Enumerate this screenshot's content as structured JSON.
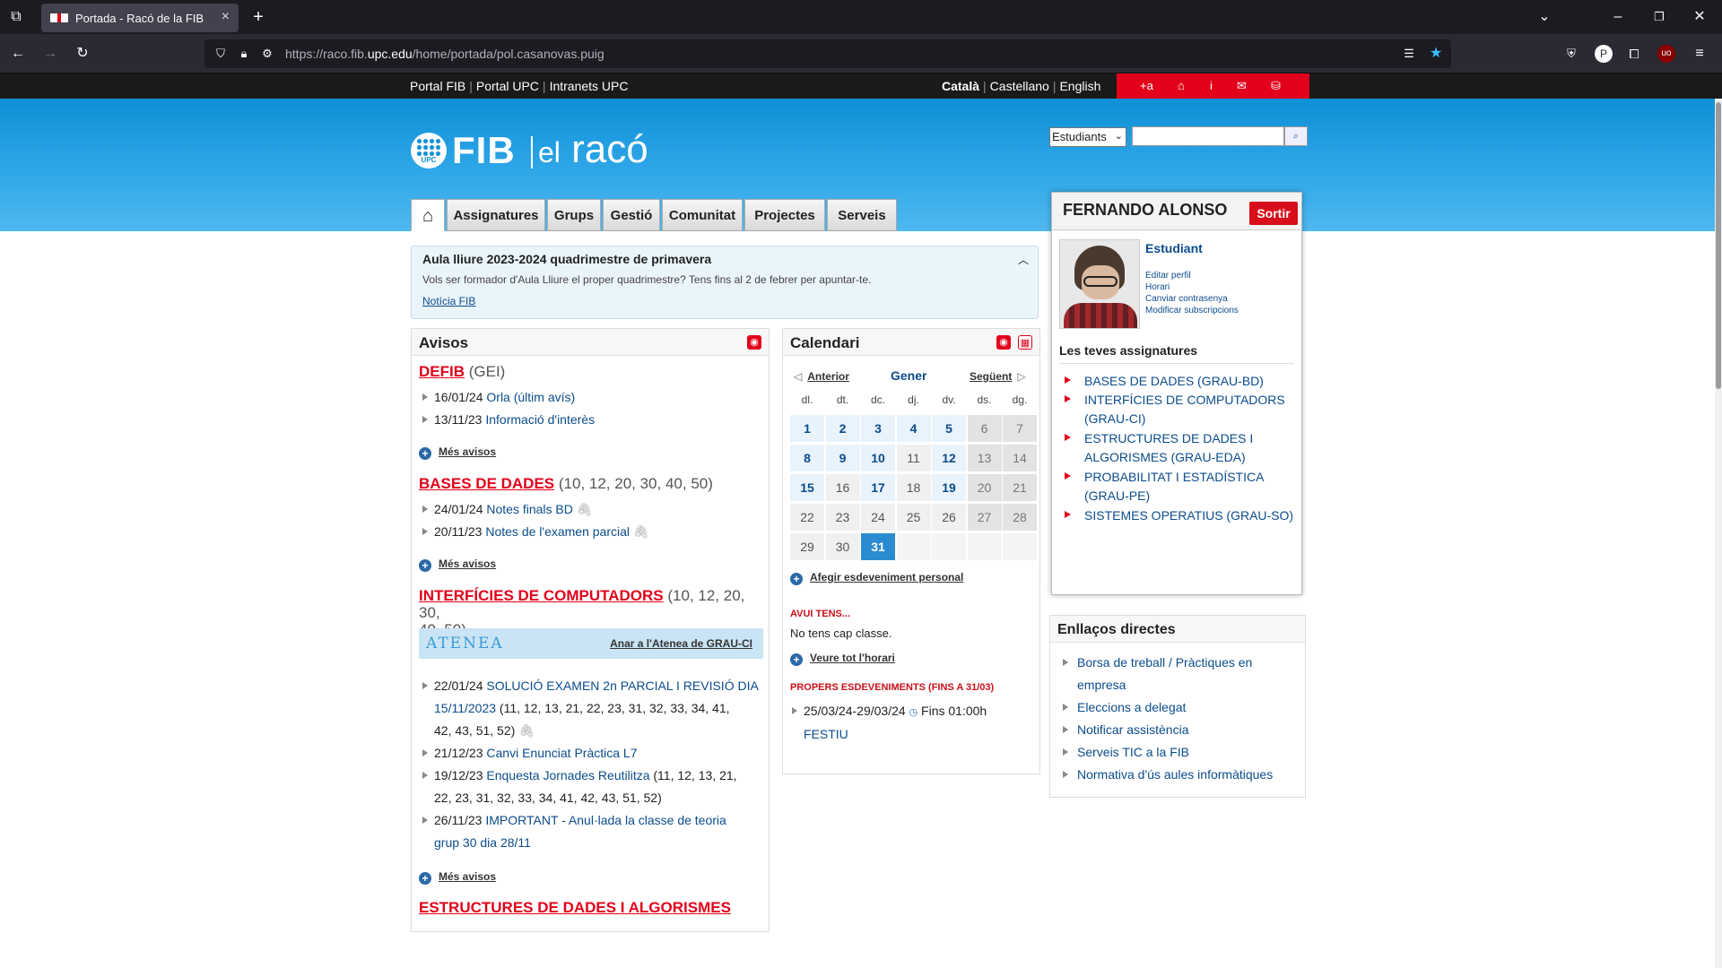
{
  "browser": {
    "tab_title": "Portada - Racó de la FIB",
    "url_prefix": "https://raco.fib.",
    "url_domain": "upc.edu",
    "url_path": "/home/portada/pol.casanovas.puig"
  },
  "topstrip": {
    "links": [
      "Portal FIB",
      "Portal UPC",
      "Intranets UPC"
    ],
    "lang_active": "Català",
    "langs": [
      "Castellano",
      "English"
    ],
    "red_icons": [
      "+a",
      "⌂",
      "i",
      "✉",
      "⛁"
    ]
  },
  "header": {
    "logo_upc": "UPC",
    "logo_fib": "FIB",
    "logo_el": "el",
    "logo_raco": "racó",
    "search_select": "Estudiants",
    "search_button": "⌕"
  },
  "nav": {
    "home_icon": "home-icon",
    "tabs": [
      "Assignatures",
      "Grups",
      "Gestió",
      "Comunitat",
      "Projectes",
      "Serveis"
    ]
  },
  "notice": {
    "title": "Aula lliure 2023-2024 quadrimestre de primavera",
    "text": "Vols ser formador d'Aula Lliure el proper quadrimestre? Tens fins al 2 de febrer per apuntar-te.",
    "link": "Notícia FIB"
  },
  "avisos": {
    "title": "Avisos",
    "sections": [
      {
        "name": "DEFIB",
        "groups": "(GEI)"
      },
      {
        "name": "BASES DE DADES",
        "groups": "(10, 12, 20, 30, 40, 50)"
      },
      {
        "name": "INTERFÍCIES DE COMPUTADORS",
        "groups": "(10, 12, 20, 30,",
        "groups2": "40, 50)"
      },
      {
        "name": "ESTRUCTURES DE DADES I ALGORISMES"
      }
    ],
    "defib_items": [
      {
        "date": "16/01/24",
        "text": "Orla (últim avís)"
      },
      {
        "date": "13/11/23",
        "text": "Informació d'interès"
      }
    ],
    "bd_items": [
      {
        "date": "24/01/24",
        "text": "Notes finals BD"
      },
      {
        "date": "20/11/23",
        "text": "Notes de l'examen parcial"
      }
    ],
    "ic_items": [
      {
        "date": "22/01/24",
        "text": "SOLUCIÓ EXAMEN 2n PARCIAL I REVISIÓ DIA",
        "l2": "15/11/2023",
        "l2b": " (11, 12, 13, 21, 22, 23, 31, 32, 33, 34, 41,",
        "l3": "42, 43, 51, 52)"
      },
      {
        "date": "21/12/23",
        "text": "Canvi Enunciat Pràctica L7"
      },
      {
        "date": "19/12/23",
        "text": "Enquesta Jornades Reutilitza",
        "tail": " (11, 12, 13, 21,",
        "l2": "22, 23, 31, 32, 33, 34, 41, 42, 43, 51, 52)"
      },
      {
        "date": "26/11/23",
        "text": "IMPORTANT - Anul·lada la classe de teoria",
        "l2": "grup 30 dia 28/11"
      }
    ],
    "mes_avisos": "Més avisos",
    "atenea_logo": "ATENEA",
    "atenea_link": "Anar a l'Atenea de GRAU-CI"
  },
  "calendar": {
    "title": "Calendari",
    "prev": "Anterior",
    "month": "Gener",
    "next": "Següent",
    "dow": [
      "dl.",
      "dt.",
      "dc.",
      "dj.",
      "dv.",
      "ds.",
      "dg."
    ],
    "add_event": "Afegir esdeveniment personal",
    "today_title": "AVUI TENS...",
    "today_text": "No tens cap classe.",
    "full_schedule": "Veure tot l'horari",
    "upcoming_title": "PROPERS ESDEVENIMENTS (FINS A 31/03)",
    "event_dates": "25/03/24-29/03/24",
    "event_time": "Fins 01:00h",
    "event_name": "FESTIU"
  },
  "user": {
    "name": "FERNANDO ALONSO",
    "logout": "Sortir",
    "role": "Estudiant",
    "links": [
      "Editar perfil",
      "Horari",
      "Canviar contrasenya",
      "Modificar subscripcions"
    ],
    "subjects_title": "Les teves assignatures",
    "subjects": [
      {
        "l1": "BASES DE DADES (GRAU-BD)"
      },
      {
        "l1": "INTERFÍCIES DE COMPUTADORS",
        "l2": "(GRAU-CI)"
      },
      {
        "l1": "ESTRUCTURES DE DADES I",
        "l2": "ALGORISMES (GRAU-EDA)"
      },
      {
        "l1": "PROBABILITAT I ESTADÍSTICA",
        "l2": "(GRAU-PE)"
      },
      {
        "l1": "SISTEMES OPERATIUS (GRAU-SO)"
      }
    ]
  },
  "links": {
    "title": "Enllaços directes",
    "items": [
      {
        "l1": "Borsa de treball / Pràctiques en",
        "l2": "empresa"
      },
      {
        "l1": "Eleccions a delegat"
      },
      {
        "l1": "Notificar assistència"
      },
      {
        "l1": "Serveis TIC a la FIB"
      },
      {
        "l1": "Normativa d'ús aules informàtiques"
      }
    ]
  }
}
